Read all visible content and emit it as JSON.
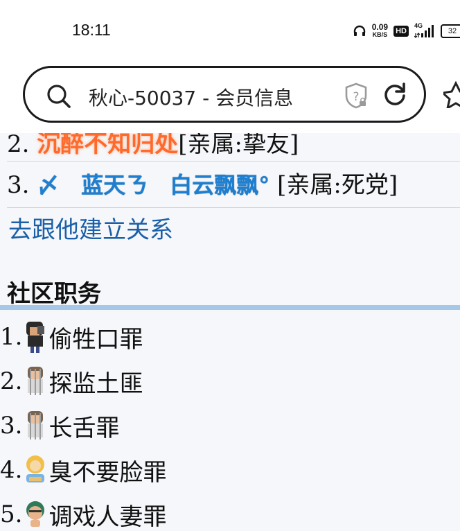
{
  "status_bar": {
    "time": "18:11",
    "net_speed_value": "0.09",
    "net_speed_unit": "KB/S",
    "hd_label": "HD",
    "network_type": "4G",
    "battery": "32"
  },
  "browser": {
    "address_text": "秋心-50037 - 会员信息"
  },
  "relations": [
    {
      "num": "2.",
      "name": "沉醉不知归处",
      "tag": "[亲属:挚友]"
    },
    {
      "num": "3.",
      "name": "〆　蓝天ㄋ　白云飘飘°",
      "tag": "[亲属:死党]"
    }
  ],
  "add_relation_link": "去跟他建立关系",
  "community": {
    "title": "社区职务",
    "items": [
      {
        "num": "1.",
        "label": "偷牲口罪"
      },
      {
        "num": "2.",
        "label": "探监土匪"
      },
      {
        "num": "3.",
        "label": "长舌罪"
      },
      {
        "num": "4.",
        "label": "臭不要脸罪"
      },
      {
        "num": "5.",
        "label": "调戏人妻罪"
      }
    ]
  },
  "colors": {
    "link": "#1a5fa8",
    "name_orange": "#ff6a2c",
    "name_blue": "#1e7fd0",
    "divider": "#a6c8e8"
  }
}
